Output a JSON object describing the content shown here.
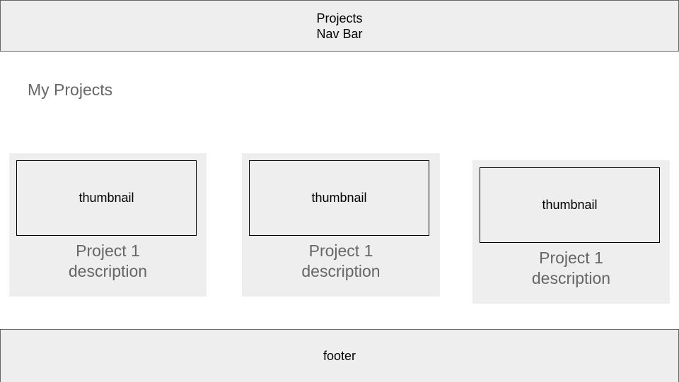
{
  "navbar": {
    "line1": "Projects",
    "line2": "Nav Bar"
  },
  "page": {
    "title": "My Projects"
  },
  "projects": [
    {
      "thumbnail_label": "thumbnail",
      "description_line1": "Project 1",
      "description_line2": "description"
    },
    {
      "thumbnail_label": "thumbnail",
      "description_line1": "Project 1",
      "description_line2": "description"
    },
    {
      "thumbnail_label": "thumbnail",
      "description_line1": "Project 1",
      "description_line2": "description"
    }
  ],
  "footer": {
    "label": "footer"
  },
  "colors": {
    "box_fill": "#eeeeee",
    "border": "#666666",
    "muted_text": "#666666",
    "text": "#000000"
  }
}
